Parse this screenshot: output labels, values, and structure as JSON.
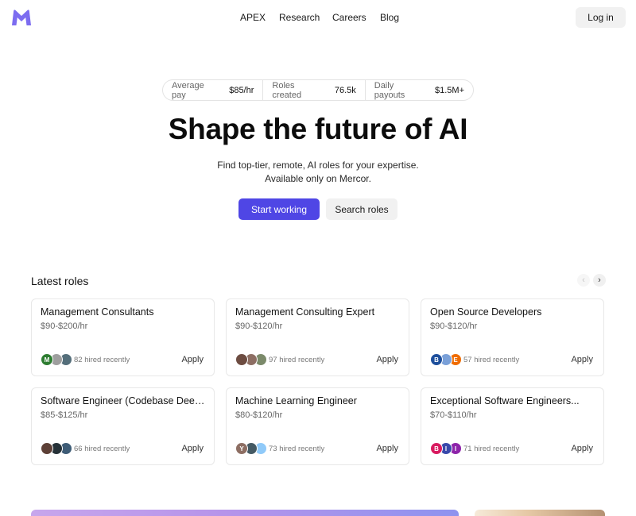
{
  "header": {
    "logo": "mercor-m-logo",
    "nav": [
      "APEX",
      "Research",
      "Careers",
      "Blog"
    ],
    "login_label": "Log in"
  },
  "stats": [
    {
      "label": "Average pay",
      "value": "$85/hr"
    },
    {
      "label": "Roles created",
      "value": "76.5k"
    },
    {
      "label": "Daily payouts",
      "value": "$1.5M+"
    }
  ],
  "hero": {
    "title": "Shape the future of AI",
    "subtitle_line1": "Find top-tier, remote, AI roles for your expertise.",
    "subtitle_line2": "Available only on Mercor.",
    "primary_cta": "Start working",
    "secondary_cta": "Search roles"
  },
  "roles_section": {
    "title": "Latest roles",
    "prev_icon": "‹",
    "next_icon": "›",
    "apply_label": "Apply",
    "roles": [
      {
        "title": "Management Consultants",
        "pay": "$90-$200/hr",
        "hired": "82 hired recently",
        "avatars": [
          {
            "letter": "M",
            "color": "#2e7d32"
          },
          {
            "letter": "",
            "color": "#9e9e9e"
          },
          {
            "letter": "",
            "color": "#546e7a"
          }
        ]
      },
      {
        "title": "Management Consulting Expert",
        "pay": "$90-$120/hr",
        "hired": "97 hired recently",
        "avatars": [
          {
            "letter": "",
            "color": "#6d4c41"
          },
          {
            "letter": "",
            "color": "#8d6e63"
          },
          {
            "letter": "",
            "color": "#7b8a6a"
          }
        ]
      },
      {
        "title": "Open Source Developers",
        "pay": "$90-$120/hr",
        "hired": "57 hired recently",
        "avatars": [
          {
            "letter": "B",
            "color": "#1e4f9c"
          },
          {
            "letter": "",
            "color": "#7aa0d8"
          },
          {
            "letter": "E",
            "color": "#ef6c00"
          }
        ]
      },
      {
        "title": "Software Engineer (Codebase Deep...",
        "pay": "$85-$125/hr",
        "hired": "66 hired recently",
        "avatars": [
          {
            "letter": "",
            "color": "#5d4037"
          },
          {
            "letter": "",
            "color": "#263238"
          },
          {
            "letter": "",
            "color": "#3e5c76"
          }
        ]
      },
      {
        "title": "Machine Learning Engineer",
        "pay": "$80-$120/hr",
        "hired": "73 hired recently",
        "avatars": [
          {
            "letter": "Y",
            "color": "#8d6e63"
          },
          {
            "letter": "",
            "color": "#455a64"
          },
          {
            "letter": "",
            "color": "#90caf9"
          }
        ]
      },
      {
        "title": "Exceptional Software Engineers...",
        "pay": "$70-$110/hr",
        "hired": "71 hired recently",
        "avatars": [
          {
            "letter": "B",
            "color": "#d81b60"
          },
          {
            "letter": "I",
            "color": "#3949ab"
          },
          {
            "letter": "I",
            "color": "#8e24aa"
          }
        ]
      }
    ]
  },
  "colors": {
    "accent": "#4f46e5",
    "logo": "#7c6cf0"
  }
}
